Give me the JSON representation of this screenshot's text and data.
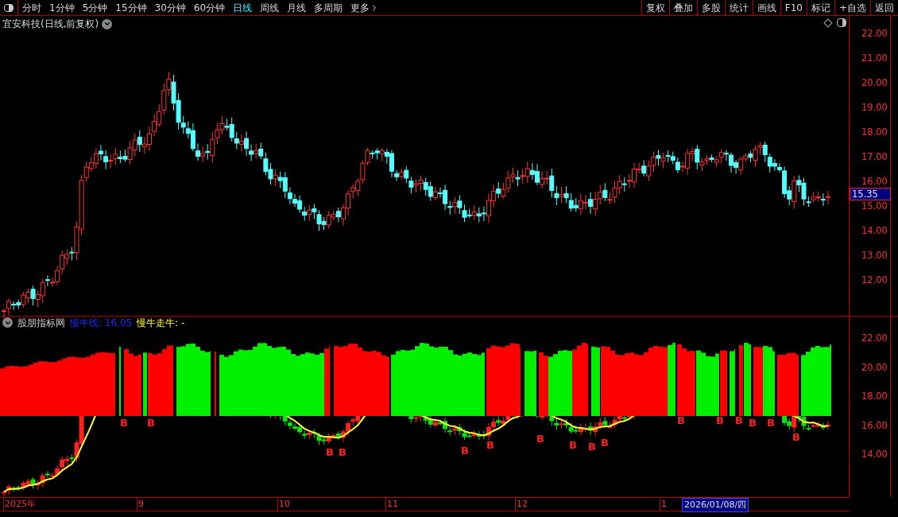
{
  "toolbar": {
    "periods": [
      {
        "label": "分时",
        "selected": false
      },
      {
        "label": "1分钟",
        "selected": false
      },
      {
        "label": "5分钟",
        "selected": false
      },
      {
        "label": "15分钟",
        "selected": false
      },
      {
        "label": "30分钟",
        "selected": false
      },
      {
        "label": "60分钟",
        "selected": false
      },
      {
        "label": "日线",
        "selected": true
      },
      {
        "label": "周线",
        "selected": false
      },
      {
        "label": "月线",
        "selected": false
      },
      {
        "label": "多周期",
        "selected": false
      }
    ],
    "more": "更多",
    "actions": [
      "复权",
      "叠加",
      "多股",
      "统计",
      "画线",
      "F10",
      "标记",
      "+自选",
      "返回"
    ]
  },
  "main_chart": {
    "title": "宜安科技(日线,前复权)",
    "price_ticks": [
      "22.00",
      "21.00",
      "20.00",
      "19.00",
      "18.00",
      "17.00",
      "16.00",
      "15.00",
      "14.00",
      "13.00",
      "12.00"
    ],
    "current_price": "15.35"
  },
  "indicator": {
    "name": "股朋指标网",
    "line_label": "慢牛线: 16.05",
    "trend_label": "慢牛走牛: -",
    "ticks": [
      "22.00",
      "20.00",
      "18.00",
      "16.00",
      "14.00"
    ],
    "signals": [
      {
        "label": "B",
        "kind": "buy"
      },
      {
        "label": "B",
        "kind": "buy"
      },
      {
        "label": "B",
        "kind": "buy"
      },
      {
        "label": "B",
        "kind": "buy"
      },
      {
        "label": "B",
        "kind": "buy"
      },
      {
        "label": "B",
        "kind": "buy"
      },
      {
        "label": "B",
        "kind": "buy"
      },
      {
        "label": "B",
        "kind": "buy"
      },
      {
        "label": "B",
        "kind": "buy"
      },
      {
        "label": "B",
        "kind": "buy"
      },
      {
        "label": "B",
        "kind": "buy"
      },
      {
        "label": "B",
        "kind": "buy"
      },
      {
        "label": "B",
        "kind": "buy"
      },
      {
        "label": "B",
        "kind": "buy"
      },
      {
        "label": "B",
        "kind": "buy"
      },
      {
        "label": "B",
        "kind": "buy"
      }
    ]
  },
  "date_axis": {
    "labels": [
      "2025年",
      "9",
      "10",
      "11",
      "12",
      "1"
    ],
    "cursor_date": "2026/01/08/四"
  }
}
